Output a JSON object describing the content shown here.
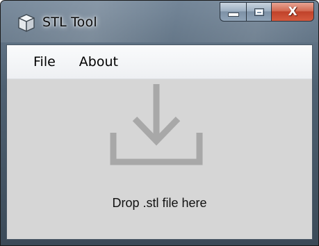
{
  "window": {
    "title": "STL Tool",
    "icon": "cube-icon"
  },
  "caption_buttons": {
    "minimize_icon": "minimize-icon",
    "maximize_icon": "maximize-icon",
    "close_icon": "close-icon"
  },
  "menu": {
    "items": [
      {
        "label": "File"
      },
      {
        "label": "About"
      }
    ]
  },
  "drop_zone": {
    "icon": "download-tray-icon",
    "text": "Drop .stl file here"
  },
  "colors": {
    "client_background": "#d6d6d6",
    "drop_icon": "#a8a8a8",
    "close_button": "#c8452c"
  }
}
